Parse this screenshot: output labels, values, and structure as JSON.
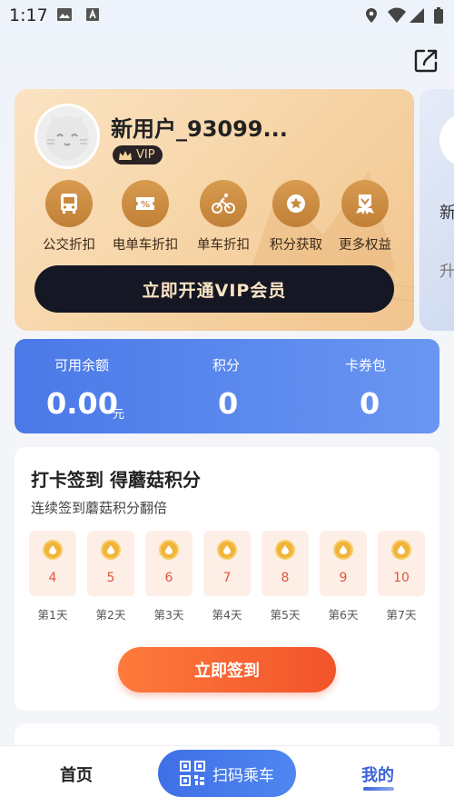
{
  "status_bar": {
    "time": "1:17"
  },
  "profile": {
    "username": "新用户_93099...",
    "vip_badge": "VIP"
  },
  "perks": [
    {
      "label": "公交折扣",
      "icon": "bus-icon"
    },
    {
      "label": "电单车折扣",
      "icon": "coupon-icon"
    },
    {
      "label": "单车折扣",
      "icon": "bicycle-icon"
    },
    {
      "label": "积分获取",
      "icon": "star-icon"
    },
    {
      "label": "更多权益",
      "icon": "more-rights-icon"
    }
  ],
  "open_vip_button": "立即开通VIP会员",
  "next_card": {
    "line1": "新",
    "line2": "升"
  },
  "balance": {
    "available_label": "可用余额",
    "available_value": "0.00",
    "available_unit": "元",
    "points_label": "积分",
    "points_value": "0",
    "coupons_label": "卡券包",
    "coupons_value": "0"
  },
  "checkin": {
    "title": "打卡签到 得蘑菇积分",
    "subtitle": "连续签到蘑菇积分翻倍",
    "days": [
      {
        "points": "4",
        "label": "第1天"
      },
      {
        "points": "5",
        "label": "第2天"
      },
      {
        "points": "6",
        "label": "第3天"
      },
      {
        "points": "7",
        "label": "第4天"
      },
      {
        "points": "8",
        "label": "第5天"
      },
      {
        "points": "9",
        "label": "第6天"
      },
      {
        "points": "10",
        "label": "第7天"
      }
    ],
    "sign_button": "立即签到"
  },
  "nav": {
    "home": "首页",
    "scan": "扫码乘车",
    "mine": "我的"
  },
  "colors": {
    "accent_blue": "#3f6fe6",
    "vip_gold": "#d89b50",
    "orange": "#f2532a"
  }
}
